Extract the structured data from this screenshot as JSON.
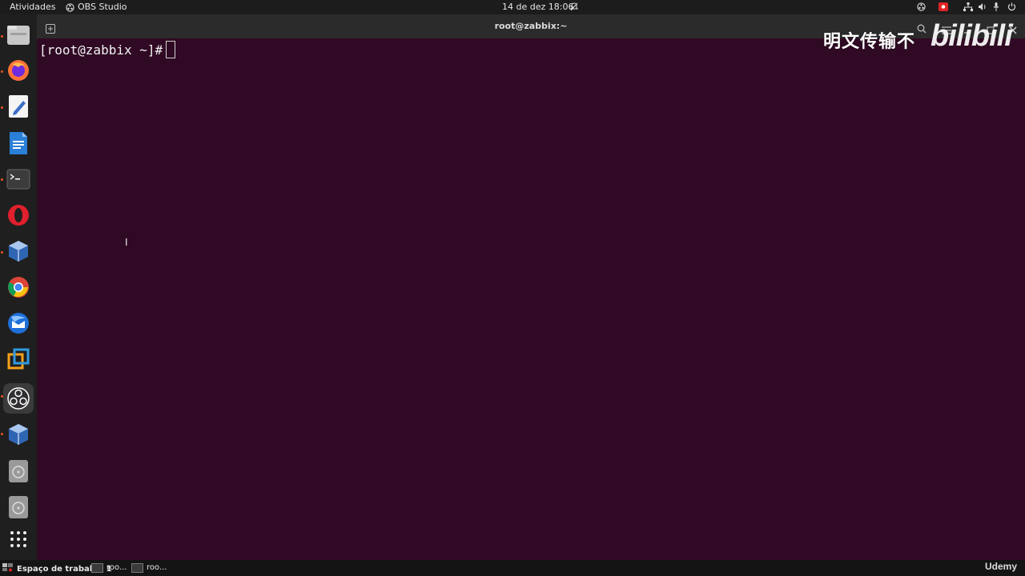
{
  "topbar": {
    "activities": "Atividades",
    "app_name": "OBS Studio",
    "clock": "14 de dez  18:06"
  },
  "window": {
    "title": "root@zabbix:~"
  },
  "terminal": {
    "prompt": "[root@zabbix ~]#"
  },
  "watermark": {
    "text": "明文传输不",
    "logo": "bilibili"
  },
  "taskbar": {
    "workspace": "Espaço de trabalho 1",
    "task1": "roo...",
    "task2": "roo...",
    "brand": "Udemy"
  },
  "colors": {
    "terminal_bg": "#300a24",
    "accent": "#e95420"
  },
  "dock": {
    "icons": [
      "files-icon",
      "firefox-icon",
      "text-editor-icon",
      "libreoffice-writer-icon",
      "terminal-icon",
      "opera-icon",
      "virtualbox-icon",
      "chrome-icon",
      "thunderbird-icon",
      "vmware-icon",
      "obs-icon",
      "virtualbox-icon",
      "disk-icon",
      "disk-icon",
      "app-grid-icon"
    ]
  }
}
